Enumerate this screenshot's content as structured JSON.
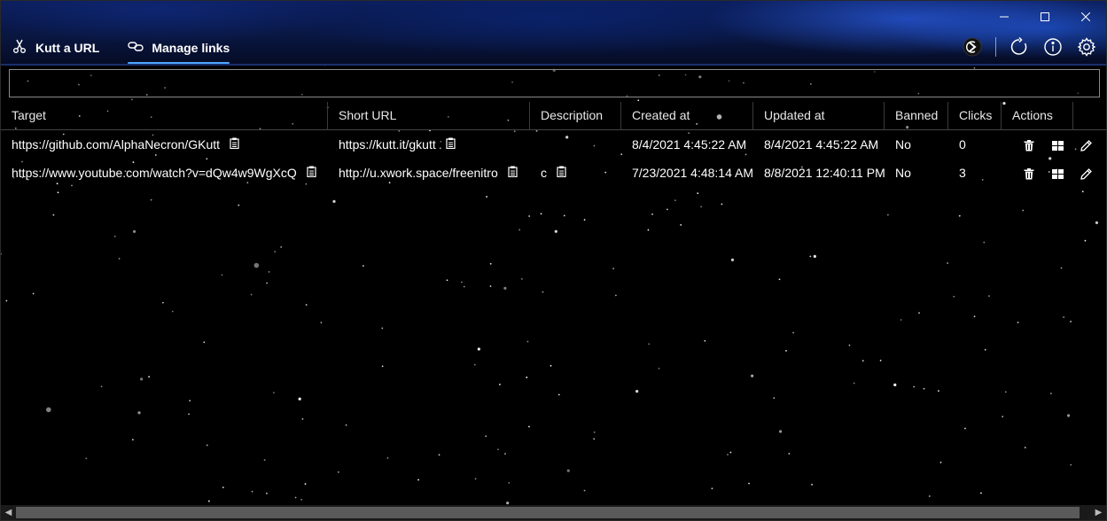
{
  "window": {
    "minimize_icon": "minimize-icon",
    "maximize_icon": "maximize-icon",
    "close_icon": "close-icon"
  },
  "nav": {
    "items": [
      {
        "label": "Kutt a URL",
        "icon": "scissors-icon",
        "active": false
      },
      {
        "label": "Manage links",
        "icon": "link-icon",
        "active": true
      }
    ]
  },
  "toolbar": {
    "icons": [
      "theme-toggle-icon",
      "refresh-icon",
      "info-icon",
      "settings-icon"
    ]
  },
  "search": {
    "value": "",
    "placeholder": ""
  },
  "table": {
    "columns": [
      "Target",
      "Short URL",
      "Description",
      "Created at",
      "Updated at",
      "Banned",
      "Clicks",
      "Actions"
    ],
    "rows": [
      {
        "target": "https://github.com/AlphaNecron/GKutt",
        "short_url": "https://kutt.it/gkutt",
        "description": "",
        "created_at": "8/4/2021 4:45:22 AM",
        "updated_at": "8/4/2021 4:45:22 AM",
        "banned": "No",
        "clicks": "0"
      },
      {
        "target": "https://www.youtube.com/watch?v=dQw4w9WgXcQ",
        "short_url": "http://u.xwork.space/freenitro",
        "description": "c",
        "created_at": "7/23/2021 4:48:14 AM",
        "updated_at": "8/8/2021 12:40:11 PM",
        "banned": "No",
        "clicks": "3"
      }
    ],
    "action_icons": [
      "delete-icon",
      "qr-code-icon",
      "edit-icon"
    ]
  },
  "colors": {
    "accent": "#4ea6ff",
    "banner": "#0b1d5a",
    "background": "#000000"
  }
}
